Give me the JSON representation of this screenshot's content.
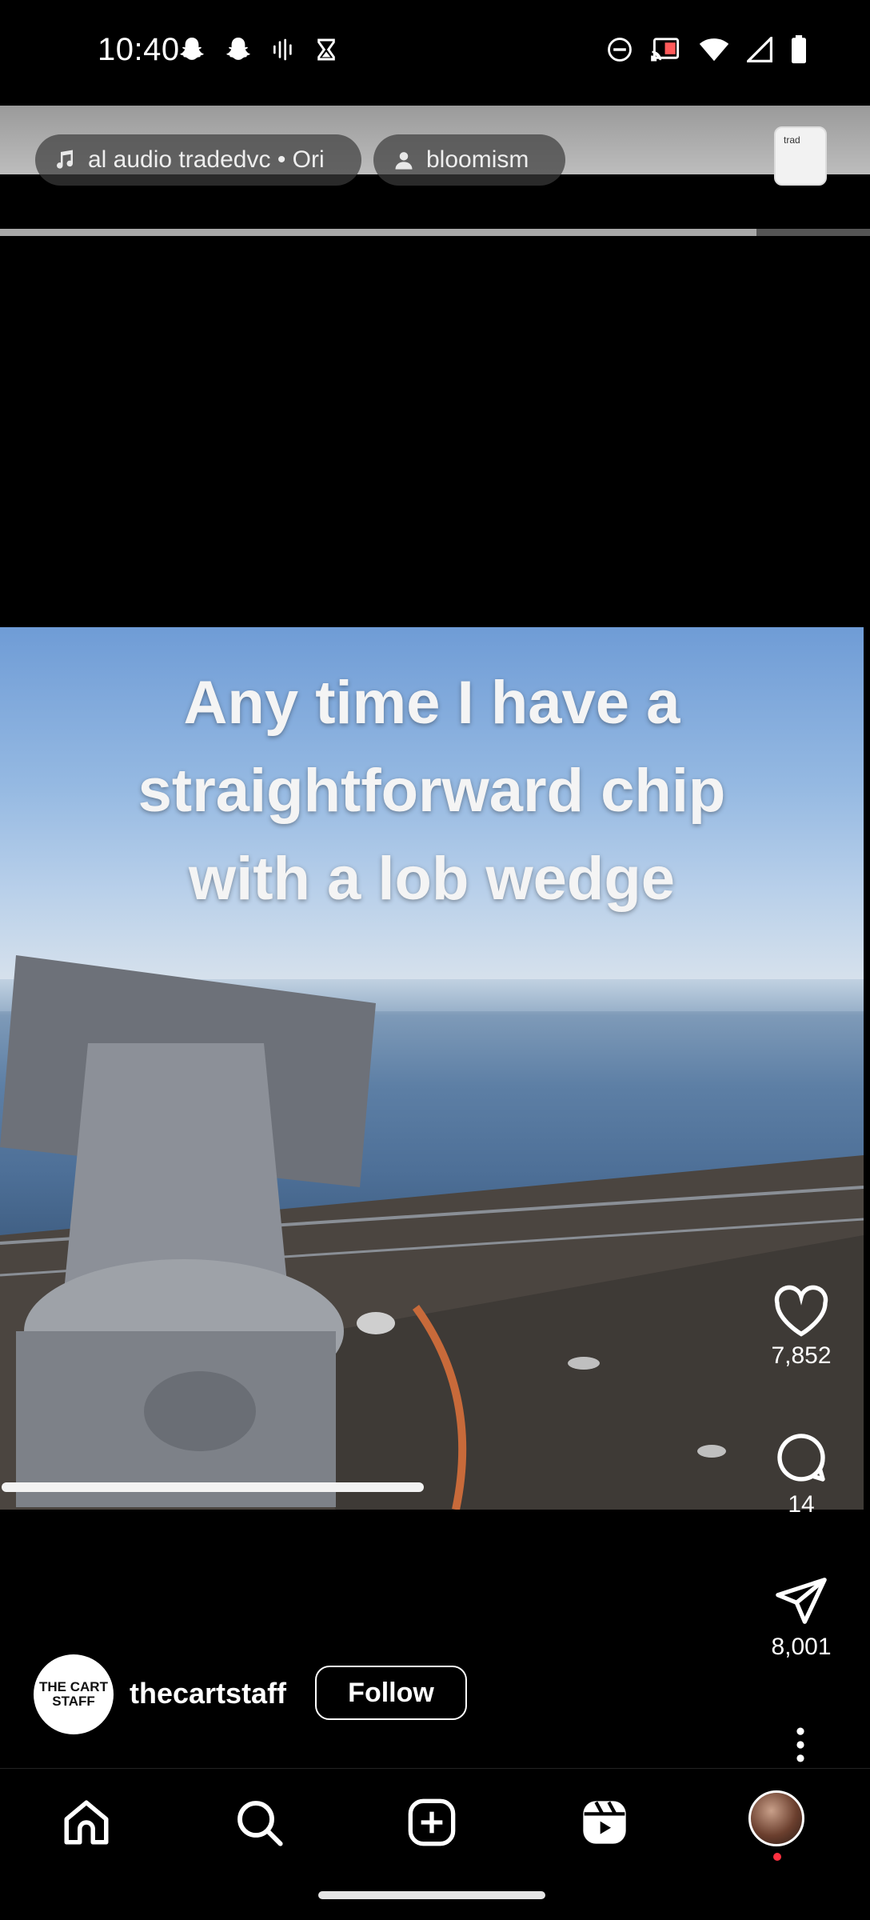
{
  "status_bar": {
    "time": "10:40",
    "left_icons": [
      "snapchat-icon",
      "snapchat-icon",
      "voice-activity-icon",
      "hourglass-icon"
    ],
    "right_icons": [
      "do-not-disturb-icon",
      "cast-icon",
      "wifi-icon",
      "cellular-icon",
      "battery-icon"
    ]
  },
  "top_strip": {
    "audio_chip_text": "al audio   tradedvc • Ori",
    "user_chip_text": "bloomism",
    "camera_button_label": "trad"
  },
  "video": {
    "caption_lines": [
      "Any time I have a",
      "straightforward chip",
      "with a lob wedge"
    ],
    "progress": 0.49
  },
  "actions": {
    "likes": "7,852",
    "comments": "14",
    "shares": "8,001"
  },
  "author": {
    "avatar_text": "THE CART STAFF",
    "name": "thecartstaff",
    "follow_label": "Follow"
  },
  "nav": {
    "items": [
      "home-icon",
      "search-icon",
      "create-icon",
      "reels-icon",
      "profile-avatar"
    ]
  },
  "colors": {
    "background": "#000000",
    "notification_dot": "#ff3040",
    "text": "#ffffff"
  }
}
